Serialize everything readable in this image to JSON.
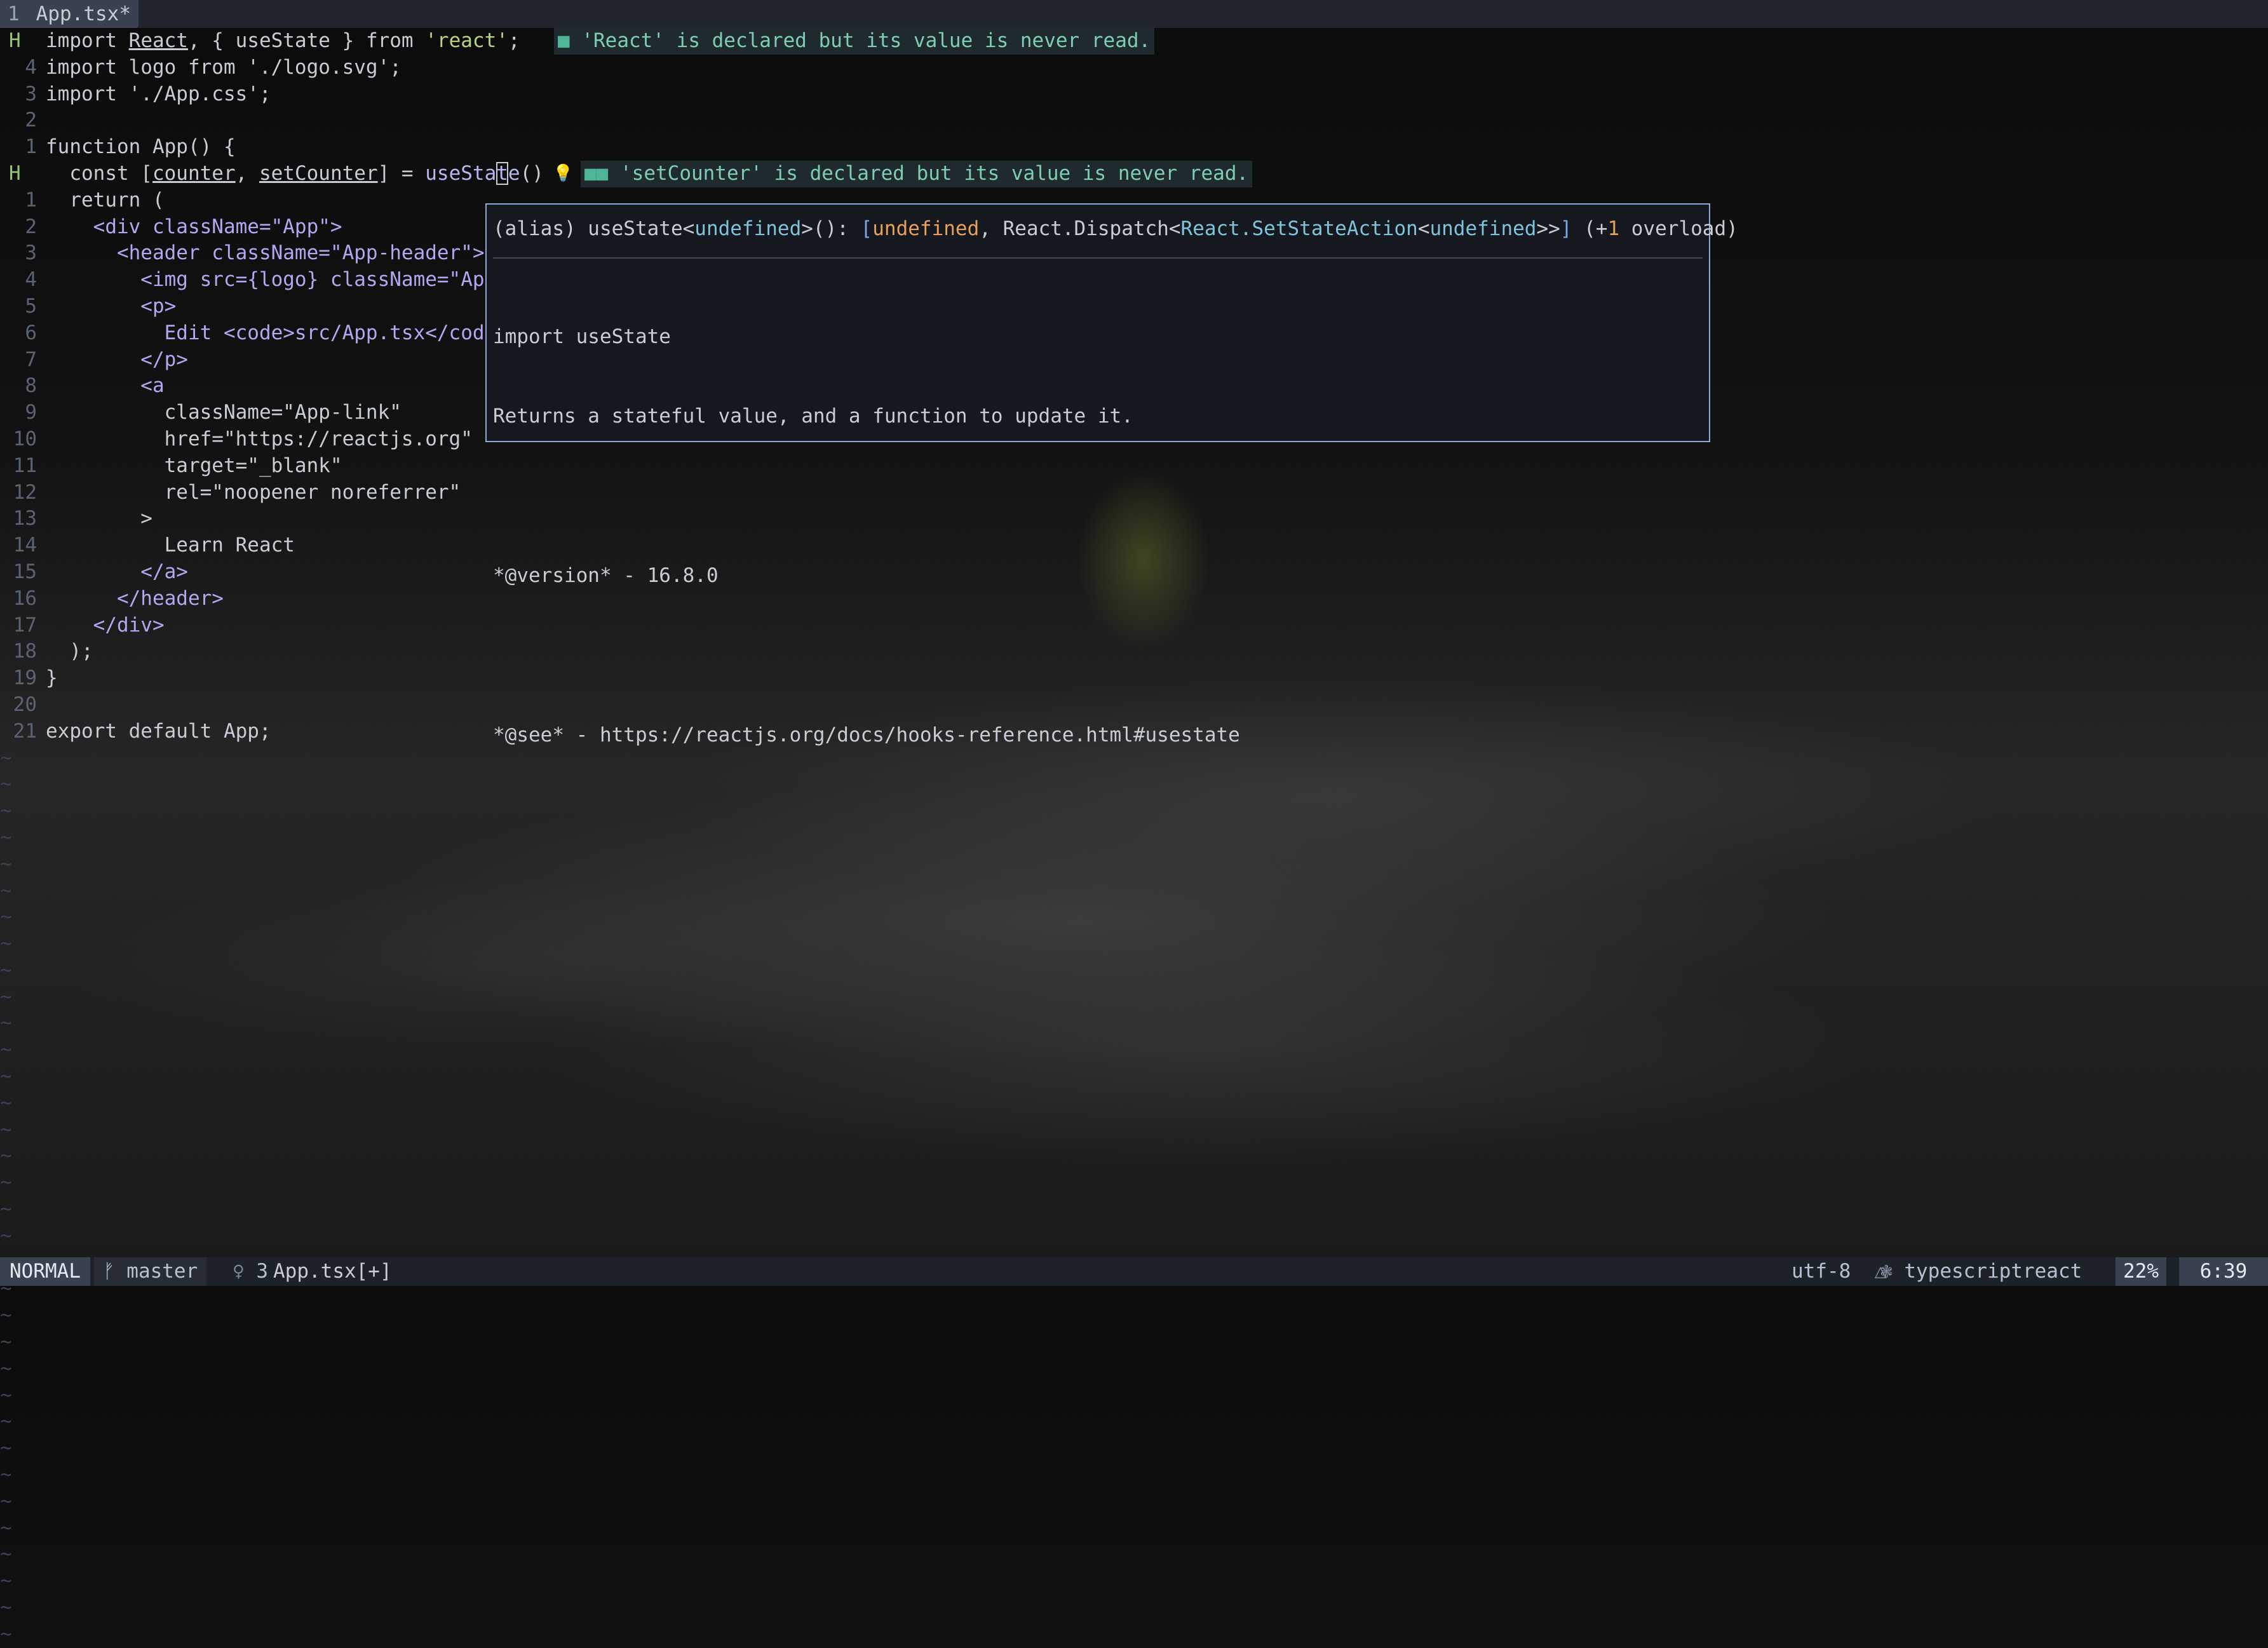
{
  "tabline": {
    "number": "1",
    "filename": "App.tsx*"
  },
  "code_lines": [
    {
      "num": "H",
      "sign": true,
      "text": ""
    },
    {
      "num": "4",
      "text": "import logo from './logo.svg';"
    },
    {
      "num": "3",
      "text": "import './App.css';"
    },
    {
      "num": "2",
      "text": ""
    },
    {
      "num": "1",
      "text": "function App() {"
    },
    {
      "num": "H",
      "sign": true,
      "text": ""
    },
    {
      "num": "1",
      "text": "  return ("
    },
    {
      "num": "2",
      "text": "    <div className=\"App\">"
    },
    {
      "num": "3",
      "text": "      <header className=\"App-header\">"
    },
    {
      "num": "4",
      "text": "        <img src={logo} className=\"App"
    },
    {
      "num": "5",
      "text": "        <p>"
    },
    {
      "num": "6",
      "text": "          Edit <code>src/App.tsx</code"
    },
    {
      "num": "7",
      "text": "        </p>"
    },
    {
      "num": "8",
      "text": "        <a"
    },
    {
      "num": "9",
      "text": "          className=\"App-link\""
    },
    {
      "num": "10",
      "text": "          href=\"https://reactjs.org\""
    },
    {
      "num": "11",
      "text": "          target=\"_blank\""
    },
    {
      "num": "12",
      "text": "          rel=\"noopener noreferrer\""
    },
    {
      "num": "13",
      "text": "        >"
    },
    {
      "num": "14",
      "text": "          Learn React"
    },
    {
      "num": "15",
      "text": "        </a>"
    },
    {
      "num": "16",
      "text": "      </header>"
    },
    {
      "num": "17",
      "text": "    </div>"
    },
    {
      "num": "18",
      "text": "  );"
    },
    {
      "num": "19",
      "text": "}"
    },
    {
      "num": "20",
      "text": ""
    },
    {
      "num": "21",
      "text": "export default App;"
    }
  ],
  "line1": {
    "import_kw": "import ",
    "react": "React",
    "rest": ", { useState } from ",
    "module": "'react'",
    "semi": ";"
  },
  "line_state": {
    "indent": "  const [",
    "counter": "counter",
    "comma": ", ",
    "setter": "setCounter",
    "mid": "] = ",
    "fn_a": "useSta",
    "fn_cursor": "t",
    "fn_b": "e",
    "parens": "()"
  },
  "diagnostics": [
    {
      "marker": "■",
      "message": "'React' is declared but its value is never read."
    },
    {
      "marker": "■■",
      "message": "'setCounter' is declared but its value is never read."
    }
  ],
  "hover": {
    "sig_prefix": "(alias) useState<",
    "sig_undefined1": "undefined",
    "sig_mid1": ">(): ",
    "sig_bracket_open": "[",
    "sig_undefined2": "undefined",
    "sig_mid2": ", React.Dispatch<",
    "sig_setstate": "React.SetStateAction",
    "sig_lt": "<",
    "sig_undefined3": "undefined",
    "sig_gtgt": ">>",
    "sig_bracket_close": "]",
    "sig_overload_open": " (+",
    "sig_overload_num": "1",
    "sig_overload_rest": " overload)",
    "doc": [
      "import useState",
      "Returns a stateful value, and a function to update it.",
      "",
      "*@version* - 16.8.0",
      "",
      "*@see* - https://reactjs.org/docs/hooks-reference.html#usestate"
    ]
  },
  "tilde": "~",
  "statusline": {
    "mode": "NORMAL",
    "branch_icon": "ᚠ",
    "branch": "master",
    "diag_icon": "♀",
    "diag_count": "3",
    "filename": "App.tsx[+]",
    "encoding": "utf-8",
    "fileformat_icon": "△",
    "filetype_icon": "❃",
    "filetype": "typescriptreact",
    "percent": "22%",
    "position": "6:39"
  }
}
